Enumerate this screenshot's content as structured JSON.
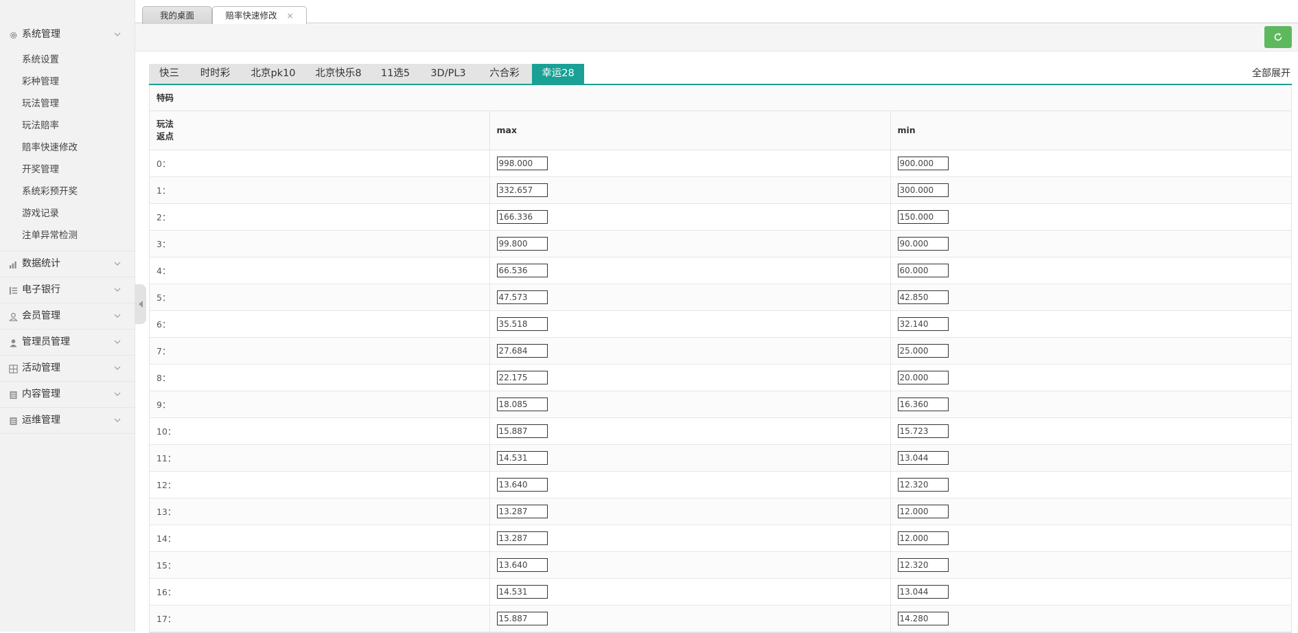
{
  "sidebar": {
    "groups": [
      {
        "label": "系统管理",
        "icon": "gear-icon",
        "expanded": true,
        "items": [
          "系统设置",
          "彩种管理",
          "玩法管理",
          "玩法赔率",
          "赔率快速修改",
          "开奖管理",
          "系统彩预开奖",
          "游戏记录",
          "注单异常检测"
        ]
      },
      {
        "label": "数据统计",
        "icon": "chart-icon"
      },
      {
        "label": "电子银行",
        "icon": "list-icon"
      },
      {
        "label": "会员管理",
        "icon": "user-outline-icon"
      },
      {
        "label": "管理员管理",
        "icon": "user-solid-icon"
      },
      {
        "label": "活动管理",
        "icon": "grid-icon"
      },
      {
        "label": "内容管理",
        "icon": "document-icon"
      },
      {
        "label": "运维管理",
        "icon": "document-icon"
      }
    ]
  },
  "page_tabs": [
    {
      "label": "我的桌面"
    },
    {
      "label": "赔率快速修改",
      "close": "×",
      "active": true
    }
  ],
  "category_tabs": [
    "快三",
    "时时彩",
    "北京pk10",
    "北京快乐8",
    "11选5",
    "3D/PL3",
    "六合彩",
    "幸运28"
  ],
  "active_category": "幸运28",
  "expand_all_label": "全部展开",
  "panel_title": "特码",
  "table": {
    "header_col1_line1": "玩法",
    "header_col1_line2": "返点",
    "header_max": "max",
    "header_min": "min",
    "rows": [
      {
        "label": "0：",
        "max": "998.000",
        "min": "900.000"
      },
      {
        "label": "1：",
        "max": "332.657",
        "min": "300.000"
      },
      {
        "label": "2：",
        "max": "166.336",
        "min": "150.000"
      },
      {
        "label": "3：",
        "max": "99.800",
        "min": "90.000"
      },
      {
        "label": "4：",
        "max": "66.536",
        "min": "60.000"
      },
      {
        "label": "5：",
        "max": "47.573",
        "min": "42.850"
      },
      {
        "label": "6：",
        "max": "35.518",
        "min": "32.140"
      },
      {
        "label": "7：",
        "max": "27.684",
        "min": "25.000"
      },
      {
        "label": "8：",
        "max": "22.175",
        "min": "20.000"
      },
      {
        "label": "9：",
        "max": "18.085",
        "min": "16.360"
      },
      {
        "label": "10：",
        "max": "15.887",
        "min": "15.723"
      },
      {
        "label": "11：",
        "max": "14.531",
        "min": "13.044"
      },
      {
        "label": "12：",
        "max": "13.640",
        "min": "12.320"
      },
      {
        "label": "13：",
        "max": "13.287",
        "min": "12.000"
      },
      {
        "label": "14：",
        "max": "13.287",
        "min": "12.000"
      },
      {
        "label": "15：",
        "max": "13.640",
        "min": "12.320"
      },
      {
        "label": "16：",
        "max": "14.531",
        "min": "13.044"
      },
      {
        "label": "17：",
        "max": "15.887",
        "min": "14.280"
      }
    ]
  },
  "colors": {
    "accent": "#1aa094",
    "refresh_button": "#5eb95e"
  }
}
